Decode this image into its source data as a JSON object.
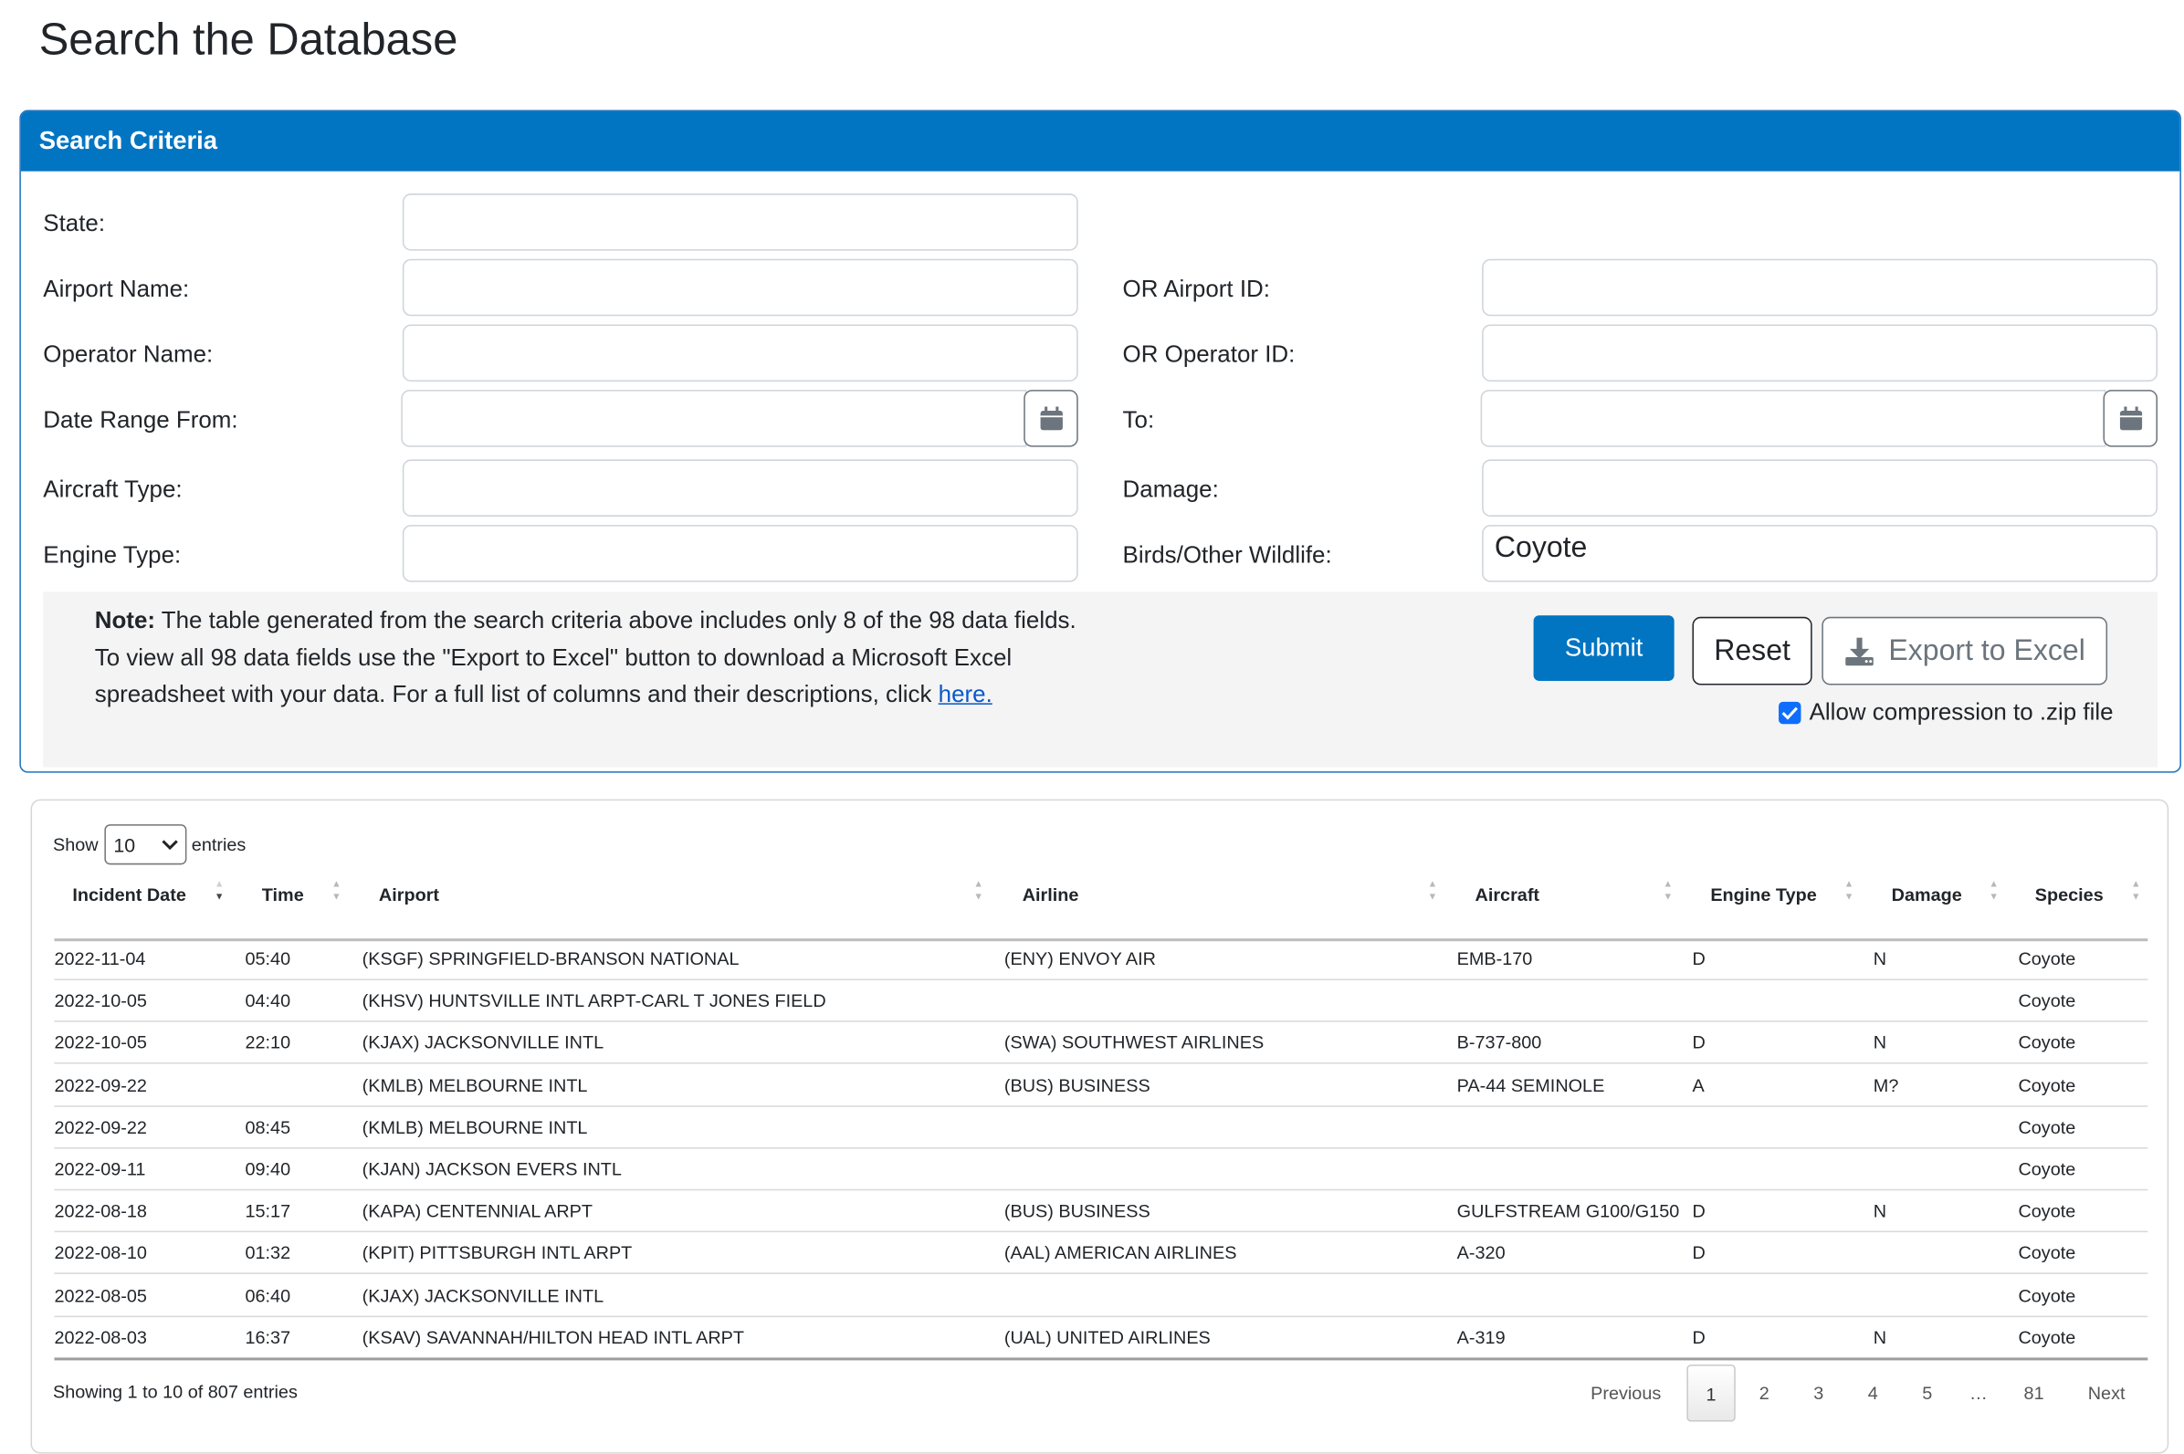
{
  "page": {
    "title": "Search the Database"
  },
  "search": {
    "header": "Search Criteria",
    "fields": {
      "state": {
        "label": "State:",
        "value": ""
      },
      "airport_name": {
        "label": "Airport Name:",
        "value": ""
      },
      "airport_id": {
        "label": "OR Airport ID:",
        "value": ""
      },
      "operator_name": {
        "label": "Operator Name:",
        "value": ""
      },
      "operator_id": {
        "label": "OR Operator ID:",
        "value": ""
      },
      "date_from": {
        "label": "Date Range From:",
        "value": ""
      },
      "date_to": {
        "label": "To:",
        "value": ""
      },
      "aircraft_type": {
        "label": "Aircraft Type:",
        "value": ""
      },
      "damage": {
        "label": "Damage:",
        "value": ""
      },
      "engine_type": {
        "label": "Engine Type:",
        "value": ""
      },
      "wildlife": {
        "label": "Birds/Other Wildlife:",
        "value": "Coyote"
      }
    },
    "note": {
      "bold": "Note:",
      "text": " The table generated from the search criteria above includes only 8 of the 98 data fields. To view all 98 data fields use the \"Export to Excel\" button to download a Microsoft Excel spreadsheet with your data. For a full list of columns and their descriptions, click ",
      "link": "here."
    },
    "buttons": {
      "submit": "Submit",
      "reset": "Reset",
      "export": "Export to Excel"
    },
    "zip_label": "Allow compression to .zip file",
    "zip_checked": true
  },
  "table": {
    "show_label": "Show",
    "entries_value": "10",
    "entries_label": "entries",
    "columns": [
      "Incident Date",
      "Time",
      "Airport",
      "Airline",
      "Aircraft",
      "Engine Type",
      "Damage",
      "Species"
    ],
    "sorted_column": "Incident Date",
    "sort_direction": "descending",
    "rows": [
      [
        "2022-11-04",
        "05:40",
        "(KSGF) SPRINGFIELD-BRANSON NATIONAL",
        "(ENY) ENVOY AIR",
        "EMB-170",
        "D",
        "N",
        "Coyote"
      ],
      [
        "2022-10-05",
        "04:40",
        "(KHSV) HUNTSVILLE INTL ARPT-CARL T JONES FIELD",
        "",
        "",
        "",
        "",
        "Coyote"
      ],
      [
        "2022-10-05",
        "22:10",
        "(KJAX) JACKSONVILLE INTL",
        "(SWA) SOUTHWEST AIRLINES",
        "B-737-800",
        "D",
        "N",
        "Coyote"
      ],
      [
        "2022-09-22",
        "",
        "(KMLB) MELBOURNE INTL",
        "(BUS) BUSINESS",
        "PA-44 SEMINOLE",
        "A",
        "M?",
        "Coyote"
      ],
      [
        "2022-09-22",
        "08:45",
        "(KMLB) MELBOURNE INTL",
        "",
        "",
        "",
        "",
        "Coyote"
      ],
      [
        "2022-09-11",
        "09:40",
        "(KJAN) JACKSON EVERS INTL",
        "",
        "",
        "",
        "",
        "Coyote"
      ],
      [
        "2022-08-18",
        "15:17",
        "(KAPA) CENTENNIAL ARPT",
        "(BUS) BUSINESS",
        "GULFSTREAM G100/G150",
        "D",
        "N",
        "Coyote"
      ],
      [
        "2022-08-10",
        "01:32",
        "(KPIT) PITTSBURGH INTL ARPT",
        "(AAL) AMERICAN AIRLINES",
        "A-320",
        "D",
        "",
        "Coyote"
      ],
      [
        "2022-08-05",
        "06:40",
        "(KJAX) JACKSONVILLE INTL",
        "",
        "",
        "",
        "",
        "Coyote"
      ],
      [
        "2022-08-03",
        "16:37",
        "(KSAV) SAVANNAH/HILTON HEAD INTL ARPT",
        "(UAL) UNITED AIRLINES",
        "A-319",
        "D",
        "N",
        "Coyote"
      ]
    ],
    "info": "Showing 1 to 10 of 807 entries",
    "pagination": {
      "previous": "Previous",
      "pages": [
        "1",
        "2",
        "3",
        "4",
        "5"
      ],
      "ellipsis": "…",
      "last": "81",
      "next": "Next",
      "current": "1"
    }
  }
}
